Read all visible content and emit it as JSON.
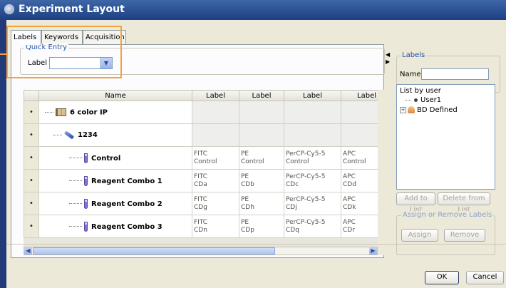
{
  "window": {
    "title": "Experiment Layout"
  },
  "tabs": [
    {
      "label": "Labels",
      "active": true
    },
    {
      "label": "Keywords",
      "active": false
    },
    {
      "label": "Acquisition",
      "active": false
    }
  ],
  "quick_entry": {
    "legend": "Quick Entry",
    "label": "Label",
    "value": ""
  },
  "grid": {
    "columns": [
      "Name",
      "Label",
      "Label",
      "Label",
      "Label"
    ],
    "rows": [
      {
        "marker": "•",
        "icon": "book-icon",
        "name": "6 color IP",
        "cells": []
      },
      {
        "marker": "•",
        "icon": "pen-icon",
        "name": "1234",
        "cells": []
      },
      {
        "marker": "•",
        "icon": "tube-icon",
        "name": "Control",
        "cells": [
          [
            "FITC",
            "Control"
          ],
          [
            "PE",
            "Control"
          ],
          [
            "PerCP-Cy5-5",
            "Control"
          ],
          [
            "APC",
            "Control"
          ]
        ]
      },
      {
        "marker": "•",
        "icon": "tube-icon",
        "name": "Reagent Combo 1",
        "cells": [
          [
            "FITC",
            "CDa"
          ],
          [
            "PE",
            "CDb"
          ],
          [
            "PerCP-Cy5-5",
            "CDc"
          ],
          [
            "APC",
            "CDd"
          ]
        ]
      },
      {
        "marker": "•",
        "icon": "tube-icon",
        "name": "Reagent Combo 2",
        "cells": [
          [
            "FITC",
            "CDg"
          ],
          [
            "PE",
            "CDh"
          ],
          [
            "PerCP-Cy5-5",
            "CDj"
          ],
          [
            "APC",
            "CDk"
          ]
        ]
      },
      {
        "marker": "•",
        "icon": "tube-icon",
        "name": "Reagent Combo 3",
        "cells": [
          [
            "FITC",
            "CDn"
          ],
          [
            "PE",
            "CDp"
          ],
          [
            "PerCP-Cy5-5",
            "CDq"
          ],
          [
            "APC",
            "CDr"
          ]
        ]
      }
    ]
  },
  "labels_panel": {
    "legend": "Labels",
    "name_label": "Name",
    "name_value": "",
    "list_title": "List by user",
    "user_item": "User1",
    "bd_item": "BD Defined",
    "add_button": "Add to List",
    "delete_button": "Delete from List",
    "assign_group": "Assign or Remove Labels",
    "assign_button": "Assign",
    "remove_button": "Remove"
  },
  "footer": {
    "ok": "OK",
    "cancel": "Cancel"
  },
  "colors": {
    "highlight": "#f4a23c",
    "titlebar": "#1d3f82",
    "dialog_bg": "#ece9d8"
  }
}
